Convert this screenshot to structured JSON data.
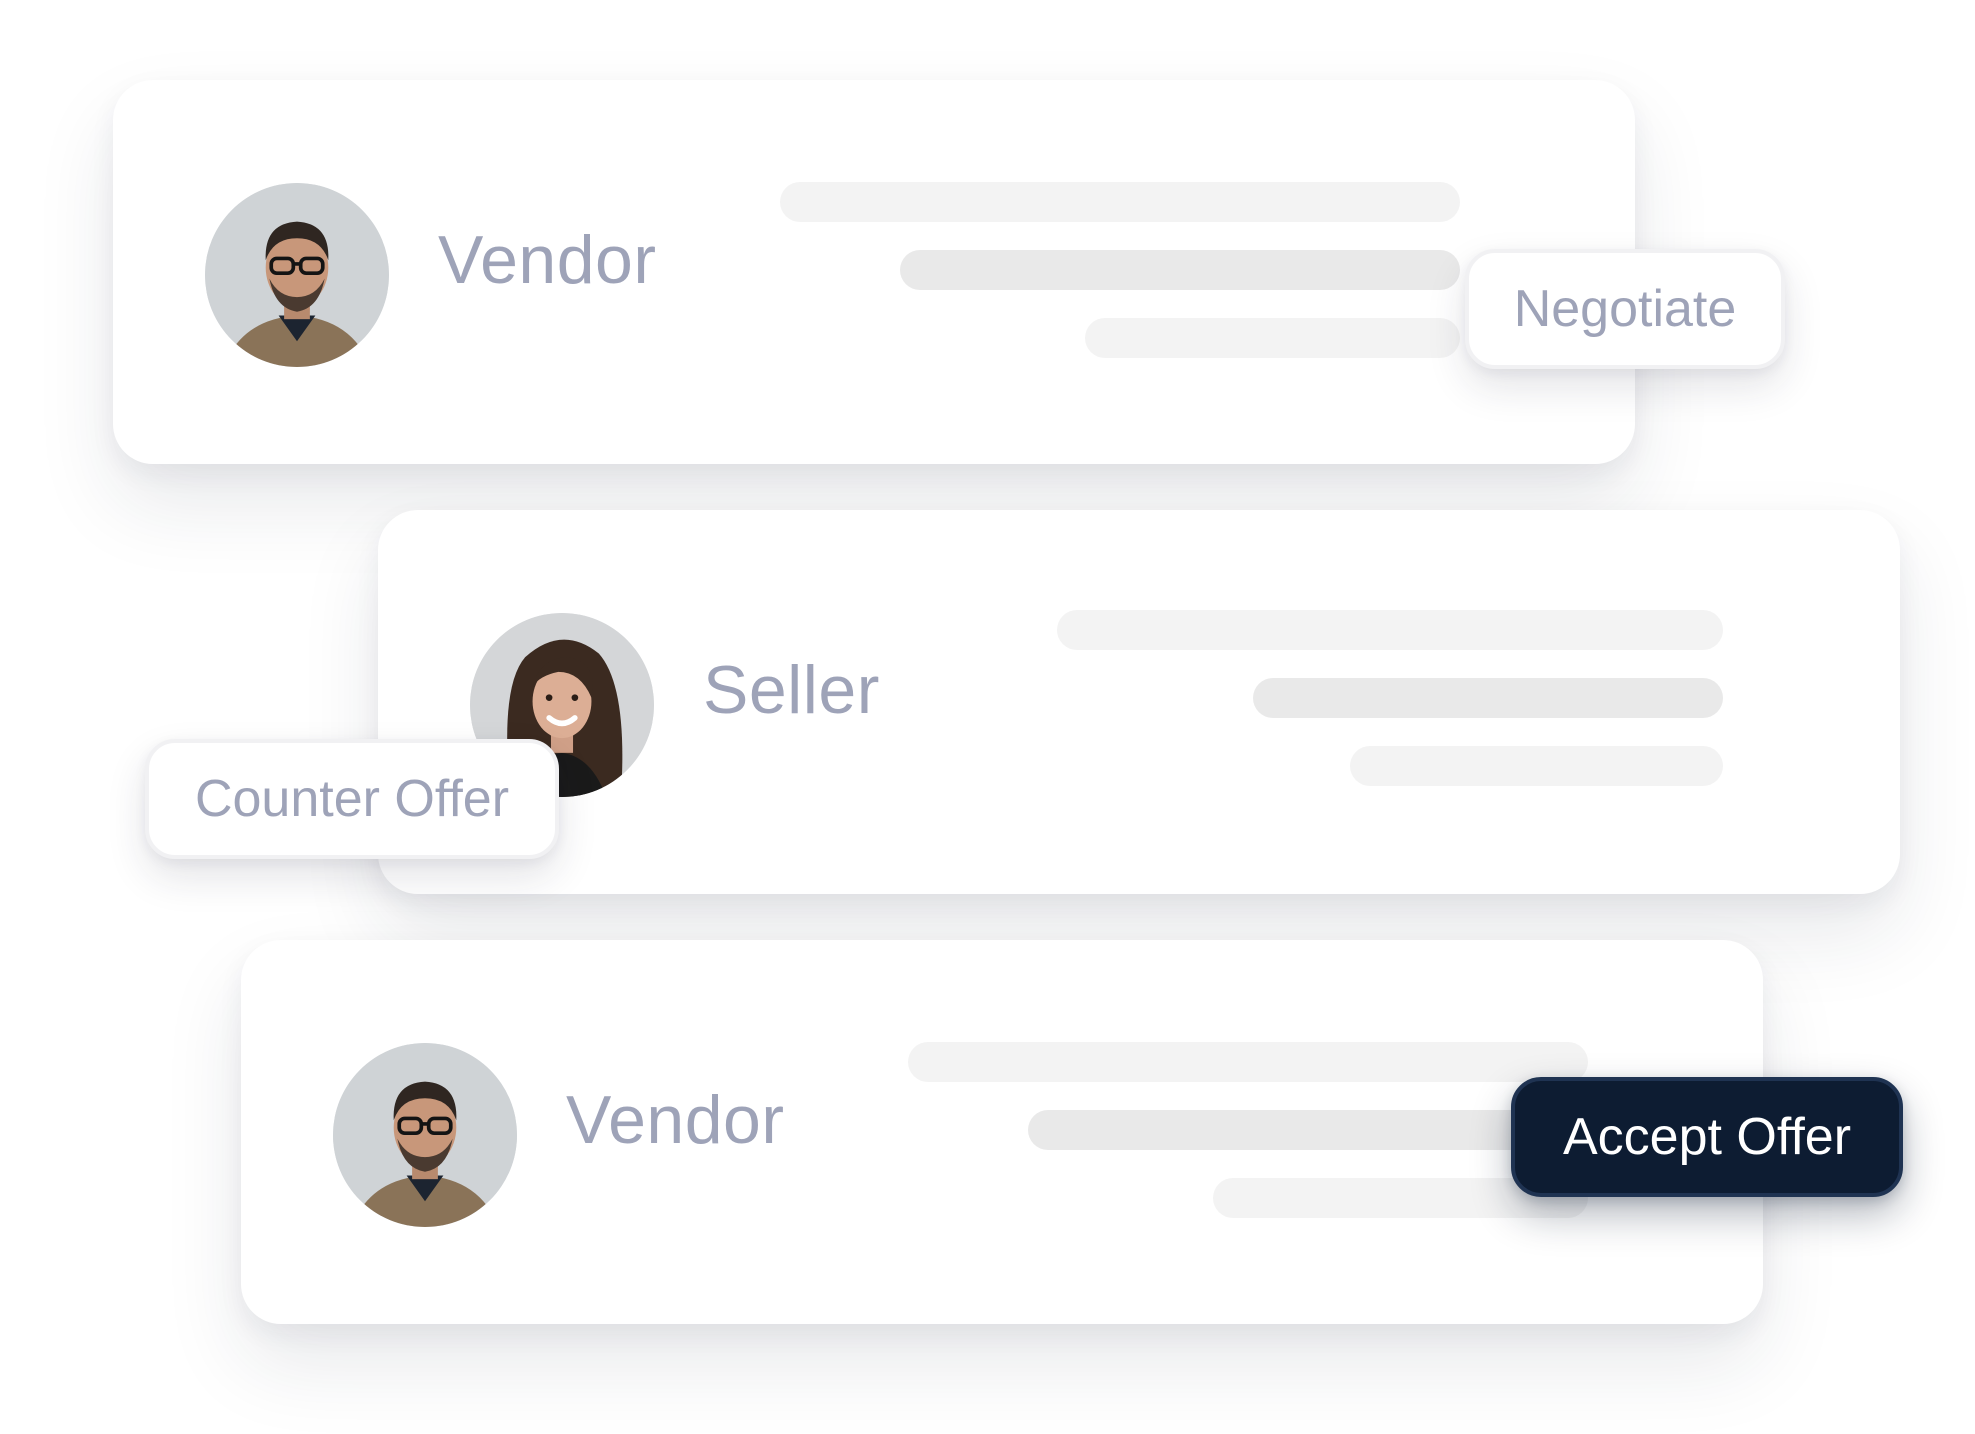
{
  "cards": [
    {
      "role": "Vendor",
      "avatar_icon": "vendor-avatar",
      "action_label": "Negotiate"
    },
    {
      "role": "Seller",
      "avatar_icon": "seller-avatar",
      "action_label": "Counter Offer"
    },
    {
      "role": "Vendor",
      "avatar_icon": "vendor-avatar",
      "action_label": "Accept Offer"
    }
  ],
  "colors": {
    "label": "#9ea3b8",
    "skeleton_light": "#f3f3f3",
    "skeleton_mid": "#e9e9e9",
    "primary_button": "#0d1c32",
    "primary_button_text": "#ffffff",
    "card_background": "#ffffff"
  }
}
